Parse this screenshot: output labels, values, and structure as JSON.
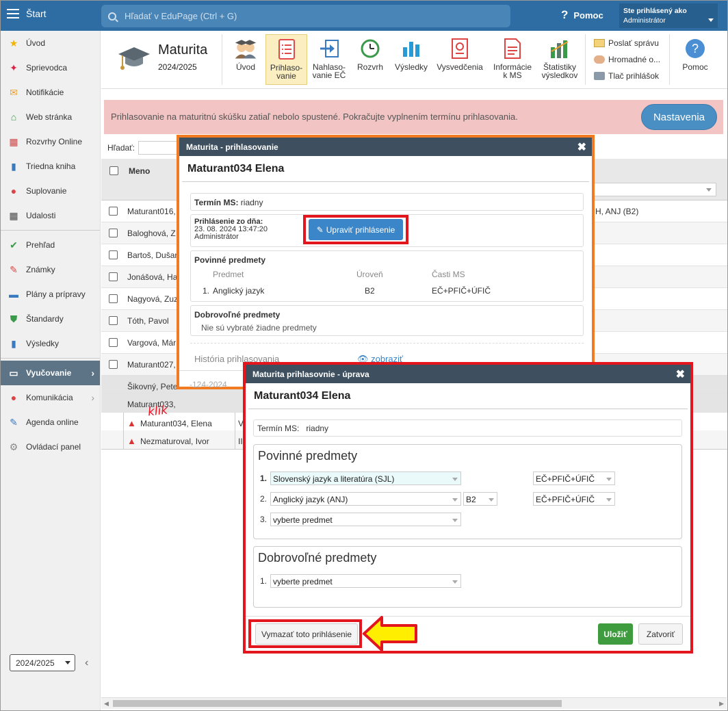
{
  "topbar": {
    "start_label": "Štart",
    "search_placeholder": "Hľadať v EduPage (Ctrl + G)",
    "help_label": "Pomoc",
    "user_line1": "Ste prihlásený ako",
    "user_line2": "Administrátor"
  },
  "sidebar": {
    "items": [
      {
        "label": "Úvod",
        "icon": "star-icon",
        "color": "#f0b400"
      },
      {
        "label": "Sprievodca",
        "icon": "wand-icon",
        "color": "#d24"
      },
      {
        "label": "Notifikácie",
        "icon": "envelope-icon",
        "color": "#e8a030"
      },
      {
        "label": "Web stránka",
        "icon": "house-icon",
        "color": "#3a9a4a"
      },
      {
        "label": "Rozvrhy Online",
        "icon": "grid-icon",
        "color": "#c44"
      },
      {
        "label": "Triedna kniha",
        "icon": "book-icon",
        "color": "#3a7ac0"
      },
      {
        "label": "Suplovanie",
        "icon": "person-icon",
        "color": "#d44"
      },
      {
        "label": "Udalosti",
        "icon": "calendar-icon",
        "color": "#444"
      },
      {
        "label": "Prehľad",
        "icon": "check-circle-icon",
        "color": "#3a9a4a"
      },
      {
        "label": "Známky",
        "icon": "grade-icon",
        "color": "#d44"
      },
      {
        "label": "Plány a prípravy",
        "icon": "briefcase-icon",
        "color": "#3a7ac0"
      },
      {
        "label": "Štandardy",
        "icon": "shield-check-icon",
        "color": "#3a9a4a"
      },
      {
        "label": "Výsledky",
        "icon": "bar-chart-icon",
        "color": "#3a7ac0"
      },
      {
        "label": "Vyučovanie",
        "icon": "open-book-icon",
        "color": "#fff"
      },
      {
        "label": "Komunikácia",
        "icon": "chat-icon",
        "color": "#d44"
      },
      {
        "label": "Agenda online",
        "icon": "pen-icon",
        "color": "#3a7ac0"
      },
      {
        "label": "Ovládací panel",
        "icon": "gear-icon",
        "color": "#888"
      }
    ],
    "year": "2024/2025"
  },
  "module": {
    "title": "Maturita",
    "year": "2024/2025"
  },
  "toolbar": {
    "buttons": [
      {
        "label1": "Úvod",
        "label2": ""
      },
      {
        "label1": "Prihlaso-",
        "label2": "vanie"
      },
      {
        "label1": "Nahlaso-",
        "label2": "vanie EČ"
      },
      {
        "label1": "Rozvrh",
        "label2": ""
      },
      {
        "label1": "Výsledky",
        "label2": ""
      },
      {
        "label1": "Vysvedčenia",
        "label2": ""
      },
      {
        "label1": "Informácie",
        "label2": "k MS"
      },
      {
        "label1": "Štatistiky",
        "label2": "výsledkov"
      }
    ],
    "side": [
      "Poslať správu",
      "Hromadné o...",
      "Tlač prihlášok"
    ],
    "help": "Pomoc"
  },
  "alert": {
    "text": "Prihlasovanie na maturitnú skúšku zatiaľ nebolo spustené. Pokračujte vyplnením termínu prihlasovania.",
    "button": "Nastavenia"
  },
  "filter": {
    "label": "Hľadať:"
  },
  "table": {
    "header": "Meno",
    "rows": [
      {
        "name": "Maturant016,",
        "extra": "H, ANJ (B2)",
        "warn": false,
        "checkbox": true
      },
      {
        "name": "Baloghová, Z",
        "extra": "",
        "warn": false,
        "checkbox": true
      },
      {
        "name": "Bartoš, Dušan",
        "extra": "",
        "warn": false,
        "checkbox": true
      },
      {
        "name": "Jonášová, Ha",
        "extra": "",
        "warn": false,
        "checkbox": true
      },
      {
        "name": "Nagyová, Zuz",
        "extra": "",
        "warn": false,
        "checkbox": true
      },
      {
        "name": "Tóth, Pavol",
        "extra": "",
        "warn": false,
        "checkbox": true
      },
      {
        "name": "Vargová, Már",
        "extra": "",
        "warn": false,
        "checkbox": true
      },
      {
        "name": "Maturant027,",
        "extra": "",
        "warn": false,
        "checkbox": true
      },
      {
        "name": "Šikovný, Pete",
        "extra": "",
        "warn": false,
        "checkbox": false
      },
      {
        "name": "Maturant033,",
        "extra": "",
        "warn": false,
        "checkbox": false
      },
      {
        "name": "Maturant034, Elena",
        "extra": "",
        "second": "V",
        "warn": true,
        "checkbox": false
      },
      {
        "name": "Nezmaturoval, Ivor",
        "extra": "",
        "second": "II",
        "warn": true,
        "checkbox": false
      }
    ]
  },
  "annotation": {
    "klik": "klik"
  },
  "dialog1": {
    "title": "Maturita - prihlasovanie",
    "student": "Maturant034 Elena",
    "term_label": "Termín MS:",
    "term_value": "riadny",
    "reg_label": "Prihlásenie zo dňa:",
    "reg_date": "23. 08. 2024 13:47:20",
    "reg_by": "Administrátor",
    "edit_button": "Upraviť prihlásenie",
    "mandatory_title": "Povinné predmety",
    "cols": [
      "Predmet",
      "Úroveň",
      "Časti MS"
    ],
    "subjects": [
      {
        "num": "1.",
        "name": "Anglický jazyk",
        "level": "B2",
        "parts": "EČ+PFIČ+ÚFIČ"
      }
    ],
    "voluntary_title": "Dobrovoľné predmety",
    "voluntary_none": "Nie sú vybraté žiadne predmety",
    "history_label": "História prihlasovania",
    "history_link": "zobraziť",
    "footer_date": "-124-2024"
  },
  "dialog2": {
    "title": "Maturita prihlasovnie - úprava",
    "student": "Maturant034 Elena",
    "term_label": "Termín MS:",
    "term_value": "riadny",
    "mandatory_title": "Povinné predmety",
    "rows": [
      {
        "num": "1.",
        "subject": "Slovenský jazyk a literatúra (SJL)",
        "level": "",
        "parts": "EČ+PFIČ+ÚFIČ"
      },
      {
        "num": "2.",
        "subject": "Anglický jazyk (ANJ)",
        "level": "B2",
        "parts": "EČ+PFIČ+ÚFIČ"
      },
      {
        "num": "3.",
        "subject": "vyberte predmet",
        "level": "",
        "parts": ""
      }
    ],
    "voluntary_title": "Dobrovoľné predmety",
    "voluntary_rows": [
      {
        "num": "1.",
        "subject": "vyberte predmet"
      }
    ],
    "delete_button": "Vymazať toto prihlásenie",
    "save_button": "Uložiť",
    "close_button": "Zatvoriť"
  }
}
